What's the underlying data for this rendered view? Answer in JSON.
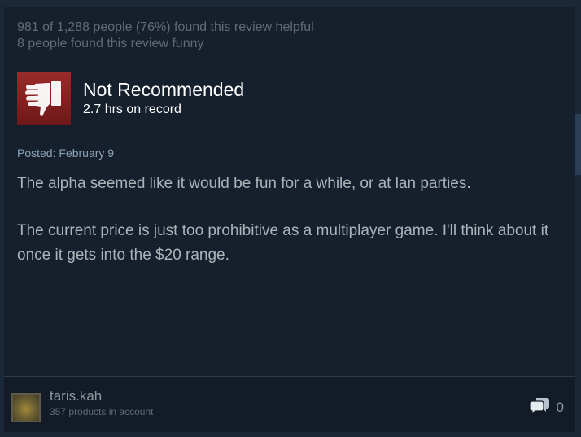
{
  "review": {
    "helpful_text": "981 of 1,288 people (76%) found this review helpful",
    "funny_text": "8 people found this review funny",
    "verdict": "Not Recommended",
    "hours": "2.7 hrs on record",
    "posted": "Posted: February 9",
    "body": [
      "The alpha seemed like it would be fun for a while, or at lan parties.",
      "The current price is just too prohibitive as a multiplayer game. I'll think about it once it gets into the $20 range."
    ]
  },
  "author": {
    "name": "taris.kah",
    "products": "357 products in account"
  },
  "comments": {
    "icon": "comment-bubbles-icon",
    "count": "0"
  },
  "colors": {
    "background": "#1b2838",
    "card": "#16202d",
    "not_recommended_red": "#9c2b2b",
    "body_text": "#acb2b8"
  }
}
